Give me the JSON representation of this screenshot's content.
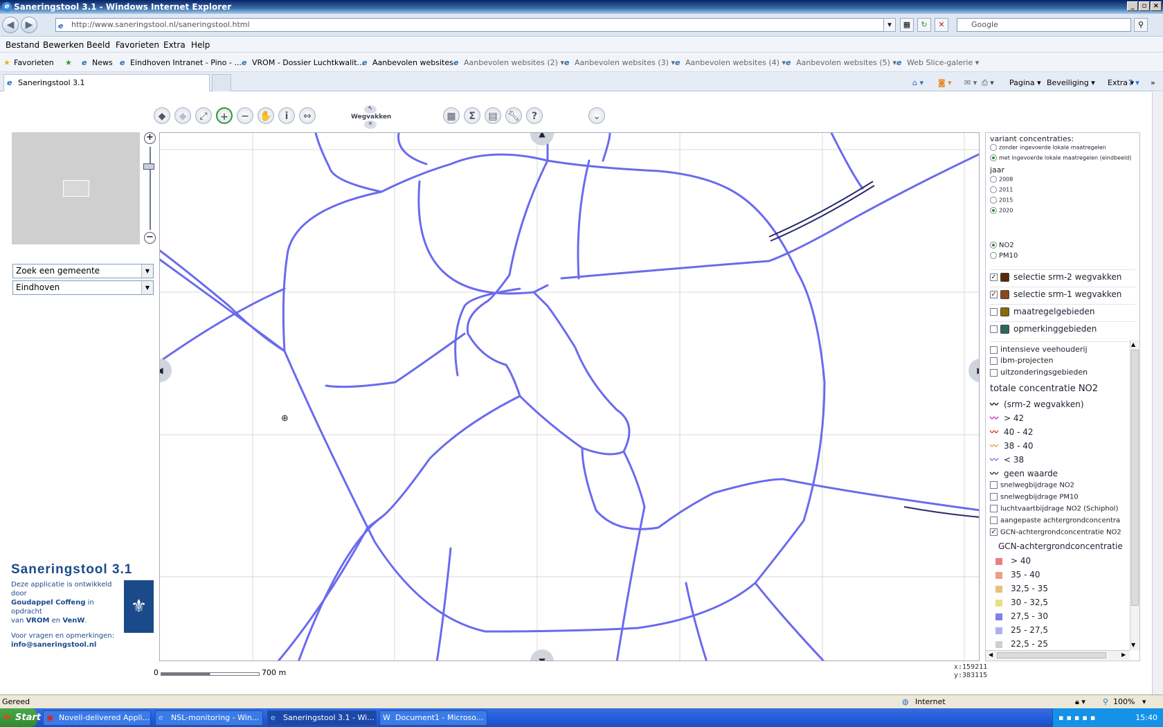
{
  "window": {
    "title": "Saneringstool 3.1 - Windows Internet Explorer"
  },
  "nav": {
    "address": "http://www.saneringstool.nl/saneringstool.html",
    "search_placeholder": "Google"
  },
  "menu": [
    "Bestand",
    "Bewerken",
    "Beeld",
    "Favorieten",
    "Extra",
    "Help"
  ],
  "favorites": {
    "label": "Favorieten",
    "items": [
      "News",
      "Eindhoven Intranet - Pino - ...",
      "VROM - Dossier Luchtkwalit...",
      "Aanbevolen websites",
      "Aanbevolen websites (2)",
      "Aanbevolen websites (3)",
      "Aanbevolen websites (4)",
      "Aanbevolen websites (5)",
      "Web Slice-galerie"
    ]
  },
  "tab": {
    "title": "Saneringstool 3.1"
  },
  "commandbar": {
    "pagina": "Pagina",
    "beveiliging": "Beveiliging",
    "extra": "Extra"
  },
  "toolbar": {
    "wegvakken_label": "Wegvakken"
  },
  "search": {
    "gemeente_placeholder": "Zoek een gemeente",
    "gemeente_value": "Eindhoven"
  },
  "map": {
    "scale_start": "0",
    "scale_label": "700 m",
    "coord_x": "x:159211",
    "coord_y": "y:383115"
  },
  "brand": {
    "title": "Saneringstool 3.1",
    "line1": "Deze applicatie is ontwikkeld door",
    "line2_bold": "Goudappel Coffeng",
    "line2_rest": " in opdracht",
    "line3_pre": "van ",
    "line3_b1": "VROM",
    "line3_mid": " en ",
    "line3_b2": "VenW",
    "line3_end": ".",
    "contact": "Voor vragen en opmerkingen:",
    "email": "info@saneringstool.nl"
  },
  "legend": {
    "variant_title": "variant concentraties:",
    "variant_options": [
      "zonder ingevoerde lokale maatregelen",
      "met ingevoerde lokale maatregelen (eindbeeld)"
    ],
    "jaar_title": "jaar",
    "years": [
      "2008",
      "2011",
      "2015",
      "2020"
    ],
    "pollutants": [
      "NO2",
      "PM10"
    ],
    "layers": [
      {
        "label": "selectie srm-2 wegvakken",
        "checked": true,
        "color": "#5a2a0a"
      },
      {
        "label": "selectie srm-1 wegvakken",
        "checked": true,
        "color": "#8a4a1a"
      },
      {
        "label": "maatregelgebieden",
        "checked": false,
        "color": "#8a6a0a"
      },
      {
        "label": "opmerkinggebieden",
        "checked": false,
        "color": "#2a6a5a"
      }
    ],
    "extra_layers": [
      "intensieve veehouderij",
      "ibm-projecten",
      "uitzonderingsgebieden"
    ],
    "totale_title": "totale concentratie NO2",
    "totale_items": [
      {
        "label": "(srm-2 wegvakken)",
        "color": "#000000"
      },
      {
        "label": "> 42",
        "color": "#c020c0"
      },
      {
        "label": "40 - 42",
        "color": "#e02020"
      },
      {
        "label": "38 - 40",
        "color": "#e0a020"
      },
      {
        "label": "< 38",
        "color": "#6a6aff"
      },
      {
        "label": "geen waarde",
        "color": "#202040"
      }
    ],
    "bijdrage_layers": [
      {
        "label": "snelwegbijdrage NO2",
        "checked": false
      },
      {
        "label": "snelwegbijdrage PM10",
        "checked": false
      },
      {
        "label": "luchtvaartbijdrage NO2 (Schiphol)",
        "checked": false
      },
      {
        "label": "aangepaste achtergrondconcentra",
        "checked": false
      },
      {
        "label": "GCN-achtergrondconcentratie NO2",
        "checked": true
      }
    ],
    "gcn_title": "GCN-achtergrondconcentratie",
    "gcn_items": [
      {
        "label": "> 40",
        "color": "#e88080"
      },
      {
        "label": "35 - 40",
        "color": "#e8a080"
      },
      {
        "label": "32,5 - 35",
        "color": "#e8c080"
      },
      {
        "label": "30 - 32,5",
        "color": "#e8e080"
      },
      {
        "label": "27,5 - 30",
        "color": "#8080e8"
      },
      {
        "label": "25 - 27,5",
        "color": "#b0b0f0"
      },
      {
        "label": "22,5 - 25",
        "color": "#d0d0d0"
      }
    ]
  },
  "status": {
    "text": "Gereed",
    "zone": "Internet",
    "zoom": "100%"
  },
  "taskbar": {
    "start": "Start",
    "tasks": [
      "Novell-delivered Appli...",
      "NSL-monitoring - Win...",
      "Saneringstool 3.1 - Wi...",
      "Document1 - Microso..."
    ],
    "clock": "15:40"
  },
  "colors": {
    "road": "#6a6aee",
    "brand": "#1b4a8a"
  }
}
